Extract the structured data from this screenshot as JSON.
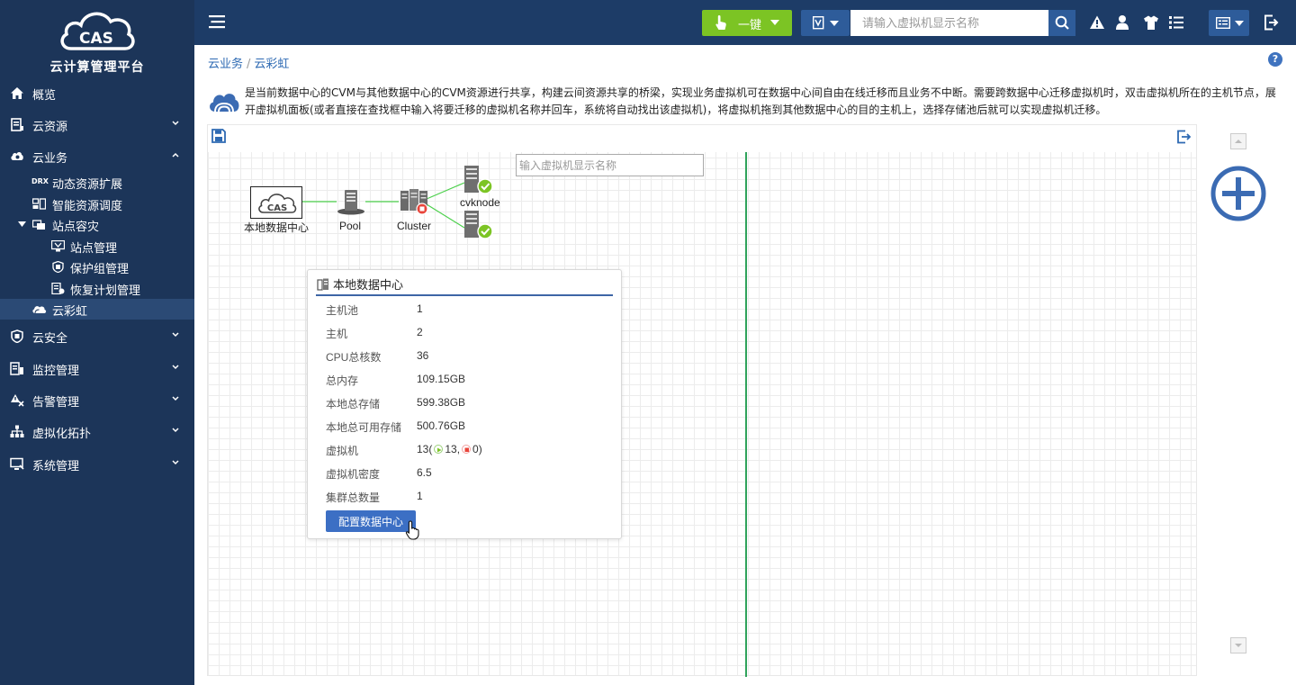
{
  "brand": {
    "logo_text": "CAS",
    "title": "云计算管理平台"
  },
  "sidebar": {
    "items": [
      {
        "label": "概览",
        "icon": "home-icon"
      },
      {
        "label": "云资源",
        "icon": "cloud-resource-icon"
      },
      {
        "label": "云业务",
        "icon": "cloud-service-icon"
      },
      {
        "label": "云安全",
        "icon": "cloud-security-icon"
      },
      {
        "label": "监控管理",
        "icon": "monitor-icon"
      },
      {
        "label": "告警管理",
        "icon": "alarm-icon"
      },
      {
        "label": "虚拟化拓扑",
        "icon": "topology-icon"
      },
      {
        "label": "系统管理",
        "icon": "system-icon"
      }
    ],
    "sub_items": [
      {
        "label": "动态资源扩展",
        "icon": "drx-icon",
        "icon_text": "DRX"
      },
      {
        "label": "智能资源调度",
        "icon": "scheduler-icon"
      },
      {
        "label": "站点容灾",
        "icon": "site-dr-icon"
      },
      {
        "label": "站点管理",
        "icon": "site-manage-icon"
      },
      {
        "label": "保护组管理",
        "icon": "protection-group-icon"
      },
      {
        "label": "恢复计划管理",
        "icon": "recovery-plan-icon"
      },
      {
        "label": "云彩虹",
        "icon": "cloud-rainbow-icon"
      }
    ]
  },
  "topbar": {
    "onekey_label": "一键",
    "search_placeholder": "请输入虚拟机显示名称"
  },
  "breadcrumb": {
    "items": [
      "云业务",
      "云彩虹"
    ],
    "separator": "/"
  },
  "description": "是当前数据中心的CVM与其他数据中心的CVM资源进行共享，构建云间资源共享的桥梁，实现业务虚拟机可在数据中心间自由在线迁移而且业务不中断。需要跨数据中心迁移虚拟机时，双击虚拟机所在的主机节点，展开虚拟机面板(或者直接在查找框中输入将要迁移的虚拟机名称并回车，系统将自动找出该虚拟机)，将虚拟机拖到其他数据中心的目的主机上，选择存储池后就可以实现虚拟机迁移。",
  "canvas": {
    "search_placeholder": "输入虚拟机显示名称",
    "nodes": {
      "datacenter": "本地数据中心",
      "pool": "Pool",
      "cluster": "Cluster",
      "host1": "cvknode"
    }
  },
  "popup": {
    "title": "本地数据中心",
    "rows": [
      {
        "key": "主机池",
        "value": "1"
      },
      {
        "key": "主机",
        "value": "2"
      },
      {
        "key": "CPU总核数",
        "value": "36"
      },
      {
        "key": "总内存",
        "value": "109.15GB"
      },
      {
        "key": "本地总存储",
        "value": "599.38GB"
      },
      {
        "key": "本地总可用存储",
        "value": "500.76GB"
      }
    ],
    "vm": {
      "key": "虚拟机",
      "total": "13(",
      "running": "13,",
      "stopped": "0)"
    },
    "rows2": [
      {
        "key": "虚拟机密度",
        "value": "6.5"
      },
      {
        "key": "集群总数量",
        "value": "1"
      }
    ],
    "button": "配置数据中心"
  },
  "colors": {
    "sidebar_bg": "#1c3559",
    "topbar_bg": "#1d3c67",
    "accent_green": "#7cc424",
    "accent_blue": "#3c6fc4",
    "divider_green": "#2fa35b"
  }
}
